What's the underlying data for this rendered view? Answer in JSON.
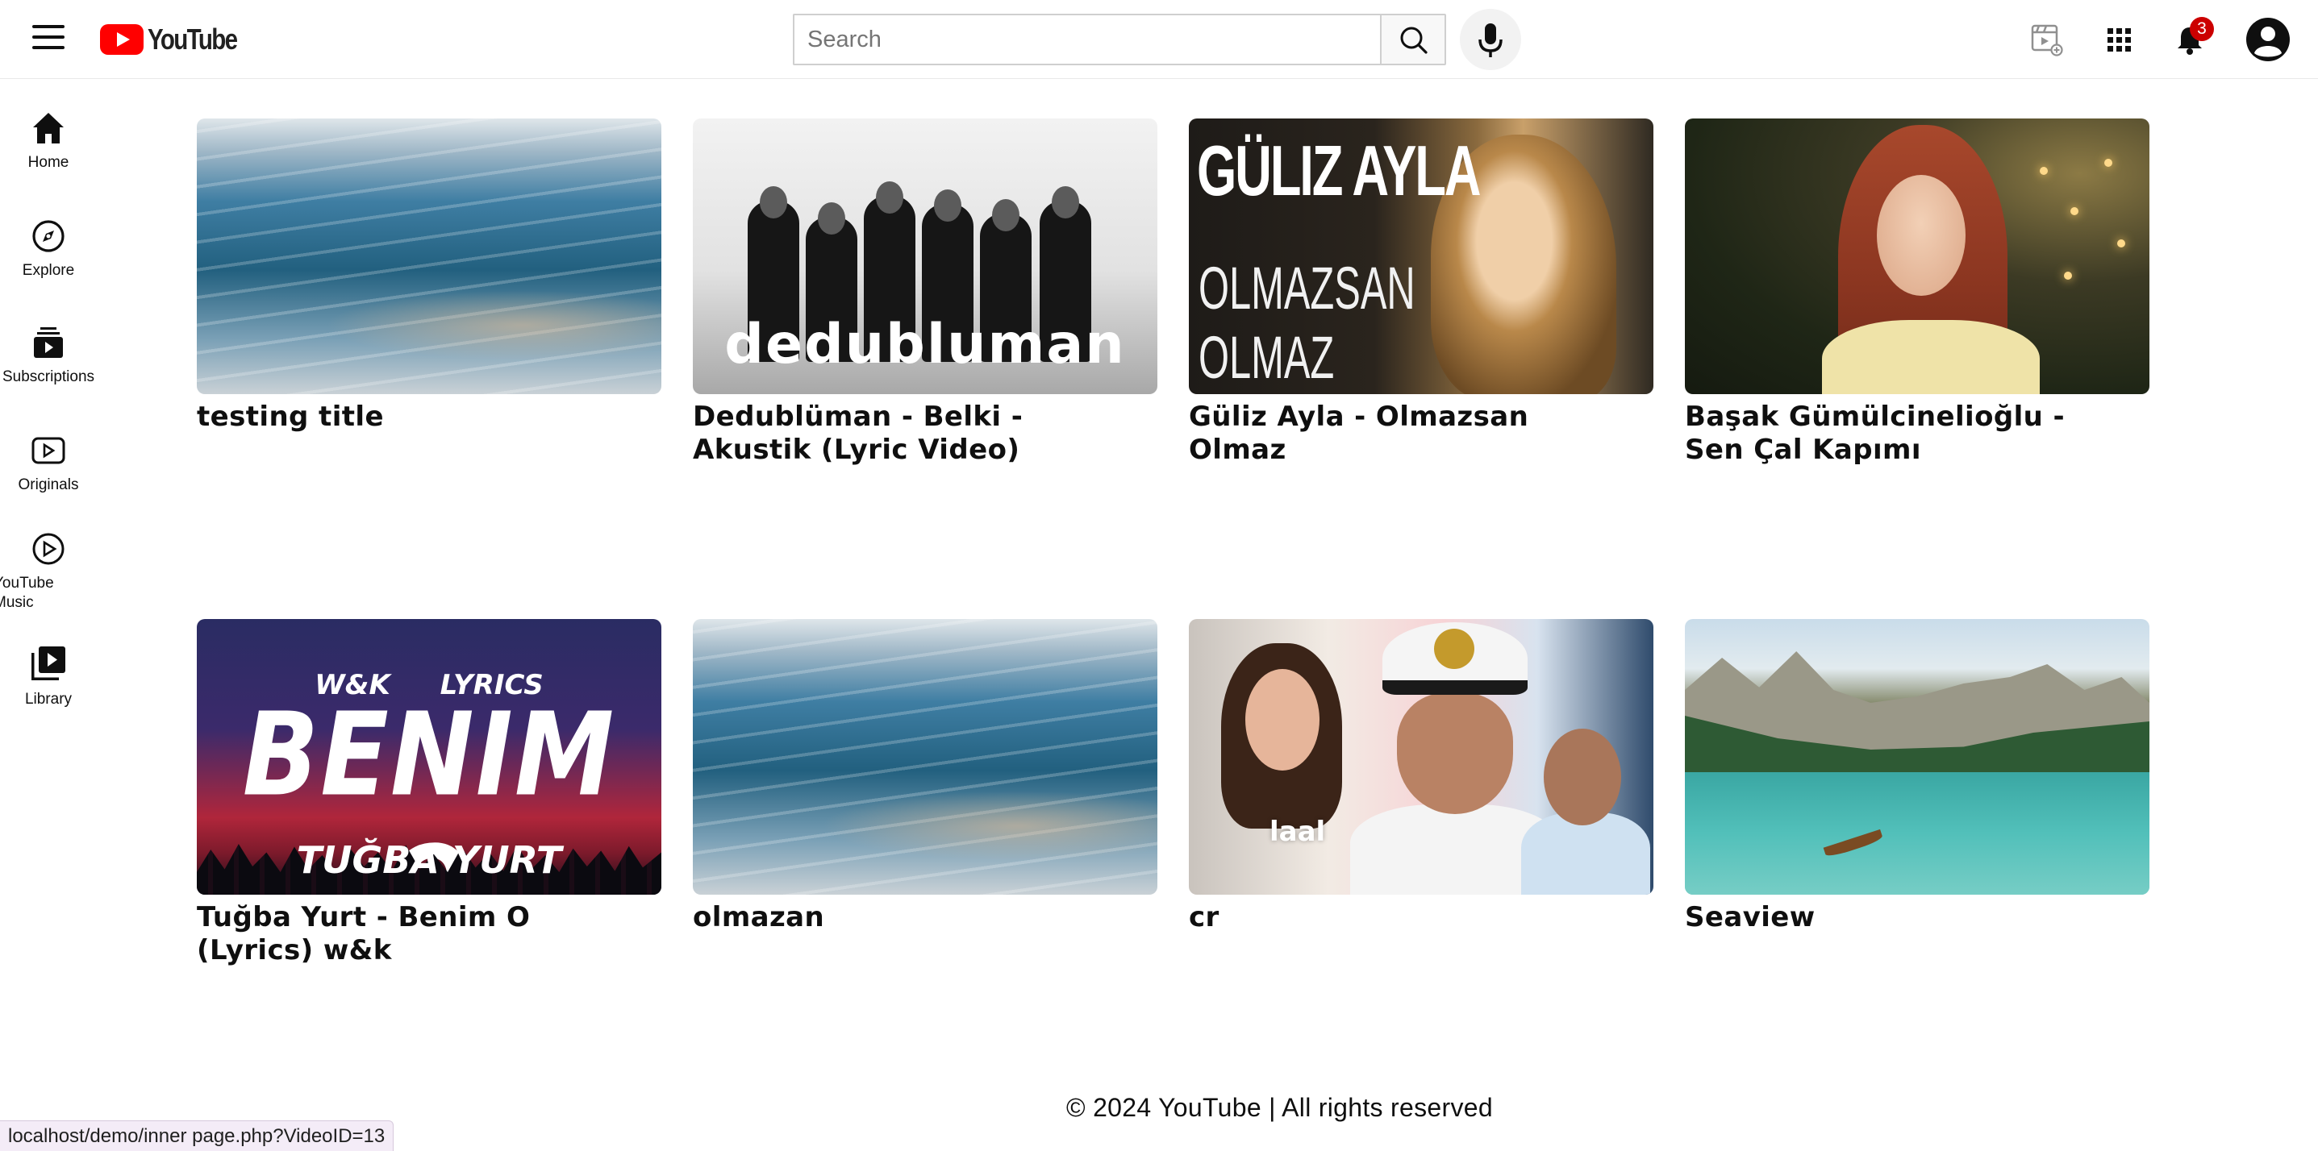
{
  "header": {
    "logo_text": "YouTube",
    "search": {
      "placeholder": "Search",
      "value": ""
    },
    "notifications_count": "3"
  },
  "sidebar": {
    "items": [
      {
        "label": "Home",
        "icon": "home-icon"
      },
      {
        "label": "Explore",
        "icon": "compass-icon"
      },
      {
        "label": "Subscriptions",
        "icon": "subscriptions-icon"
      },
      {
        "label": "Originals",
        "icon": "originals-icon"
      },
      {
        "label": "YouTube Music",
        "icon": "music-play-icon"
      },
      {
        "label": "Library",
        "icon": "library-icon"
      }
    ]
  },
  "videos": [
    {
      "title": "testing title",
      "thumbnail": "ocean-waves"
    },
    {
      "title": "Dedublüman - Belki - Akustik (Lyric Video)",
      "thumbnail": "band-photo",
      "thumb_text": "dedubluman"
    },
    {
      "title": "Güliz Ayla - Olmazsan Olmaz",
      "thumbnail": "singer-portrait",
      "thumb_text_big": "GÜLIZ AYLA",
      "thumb_text_sub": "OLMAZSAN OLMAZ"
    },
    {
      "title": "Başak Gümülcinelioğlu - Sen Çal Kapımı",
      "thumbnail": "red-haired-singer"
    },
    {
      "title": "Tuğba Yurt - Benim O (Lyrics) w&k",
      "thumbnail": "lyrics-poster",
      "thumb_text_top": "W&K LYRICS",
      "thumb_text_big": "BENIM O",
      "thumb_text_name": "TUĞBA YURT"
    },
    {
      "title": "olmazan",
      "thumbnail": "ocean-waves"
    },
    {
      "title": "cr",
      "thumbnail": "drama-poster",
      "thumb_text": "laal"
    },
    {
      "title": "Seaview",
      "thumbnail": "mountain-lake"
    }
  ],
  "footer": {
    "text": "© 2024 YouTube | All rights reserved"
  },
  "status_bar": {
    "url": "localhost/demo/inner page.php?VideoID=13"
  },
  "colors": {
    "brand_red": "#ff0000",
    "badge_red": "#cc0000",
    "text": "#0f0f0f"
  }
}
